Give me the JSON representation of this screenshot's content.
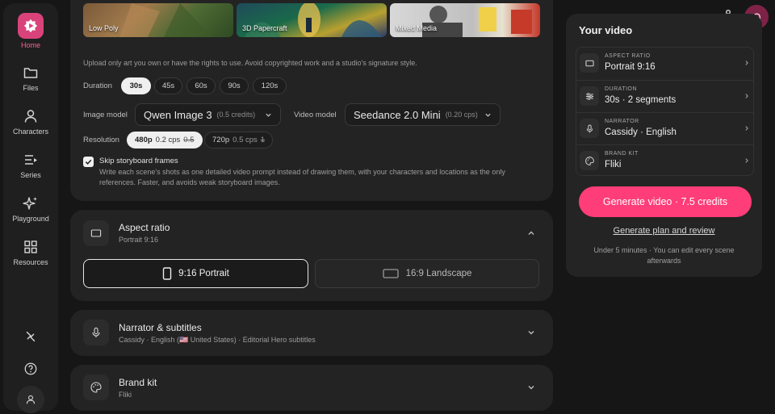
{
  "sidebar": {
    "items": [
      {
        "label": "Home",
        "icon": "home-icon"
      },
      {
        "label": "Files",
        "icon": "folder-icon"
      },
      {
        "label": "Characters",
        "icon": "person-icon"
      },
      {
        "label": "Series",
        "icon": "series-icon"
      },
      {
        "label": "Playground",
        "icon": "sparkle-icon"
      },
      {
        "label": "Resources",
        "icon": "grid-icon"
      }
    ],
    "bottom_icons": [
      "integrations-icon",
      "help-icon",
      "profile-icon"
    ]
  },
  "styles": {
    "thumbs": [
      "Low Poly",
      "3D Papercraft",
      "Mixed Media"
    ],
    "note": "Upload only art you own or have the rights to use. Avoid copyrighted work and a studio's signature style."
  },
  "duration": {
    "label": "Duration",
    "options": [
      "30s",
      "45s",
      "60s",
      "90s",
      "120s"
    ],
    "selected": "30s"
  },
  "image_model": {
    "label": "Image model",
    "value": "Qwen Image 3",
    "credits": "(0.5 credits)"
  },
  "video_model": {
    "label": "Video model",
    "value": "Seedance 2.0 Mini",
    "credits": "(0.20 cps)"
  },
  "resolution": {
    "label": "Resolution",
    "options": [
      {
        "name": "480p",
        "rate": "0.2 cps",
        "old": "0.5"
      },
      {
        "name": "720p",
        "rate": "0.5 cps",
        "old": "1"
      }
    ],
    "selected": "480p"
  },
  "skip_storyboard": {
    "checked": true,
    "title": "Skip storyboard frames",
    "description": "Write each scene's shots as one detailed video prompt instead of drawing them, with your characters and locations as the only references. Faster, and avoids weak storyboard images."
  },
  "aspect_section": {
    "title": "Aspect ratio",
    "subtitle": "Portrait 9:16",
    "options": [
      "9:16 Portrait",
      "16:9 Landscape"
    ],
    "selected": "9:16 Portrait"
  },
  "narrator_section": {
    "title": "Narrator & subtitles",
    "subtitle": "Cassidy · English (🇺🇸 United States) · Editorial Hero subtitles"
  },
  "brand_section": {
    "title": "Brand kit",
    "subtitle": "Fliki"
  },
  "summary": {
    "title": "Your video",
    "items": [
      {
        "label": "ASPECT RATIO",
        "value": "Portrait 9:16",
        "icon": "aspect-icon"
      },
      {
        "label": "DURATION",
        "value": "30s · 2 segments",
        "icon": "sliders-icon"
      },
      {
        "label": "NARRATOR",
        "value": "Cassidy · English",
        "icon": "mic-icon"
      },
      {
        "label": "BRAND KIT",
        "value": "Fliki",
        "icon": "palette-icon"
      }
    ],
    "generate_button": "Generate video · 7.5 credits",
    "plan_link": "Generate plan and review",
    "note": "Under 5 minutes · You can edit every scene afterwards"
  },
  "colors": {
    "accent": "#ff3d78",
    "background": "#161616",
    "panel": "#232323",
    "bell": "#7e2347"
  }
}
